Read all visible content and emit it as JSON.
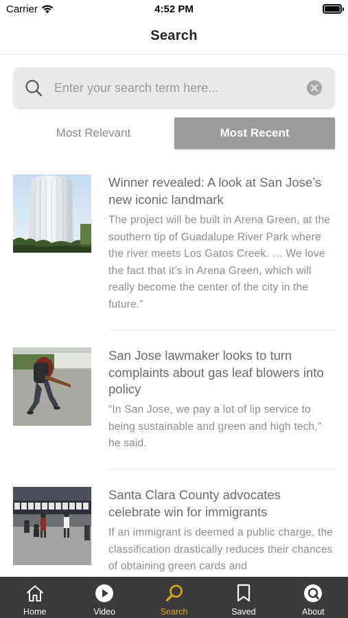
{
  "status_bar": {
    "carrier": "Carrier",
    "time": "4:52 PM"
  },
  "nav": {
    "title": "Search"
  },
  "search": {
    "placeholder": "Enter your search term here..."
  },
  "segments": {
    "relevant": "Most Relevant",
    "recent": "Most Recent",
    "selected": "Most Recent"
  },
  "articles": [
    {
      "title": "Winner revealed: A look at San Jose’s new iconic landmark",
      "excerpt": "The project will be built in Arena Green, at the southern tip of Guadalupe River Park where the river meets Los Gatos Creek. … We love the fact that it’s in Arena Green, which will really become the center of the city in the future.”"
    },
    {
      "title": "San Jose lawmaker looks to turn complaints about gas leaf blowers into policy",
      "excerpt": "“In San Jose, we pay a lot of lip service to being sustainable and green and high tech,” he said."
    },
    {
      "title": "Santa Clara County advocates celebrate win for immigrants",
      "excerpt": "If an immigrant is deemed a public charge, the classification drastically reduces their chances of obtaining green cards and"
    }
  ],
  "tabs": [
    {
      "label": "Home",
      "icon": "home-icon"
    },
    {
      "label": "Video",
      "icon": "play-icon"
    },
    {
      "label": "Search",
      "icon": "search-icon",
      "active": true
    },
    {
      "label": "Saved",
      "icon": "bookmark-icon"
    },
    {
      "label": "About",
      "icon": "about-icon"
    }
  ],
  "colors": {
    "accent": "#d9a81c",
    "tab_bar": "#3a3a3a",
    "segment_selected": "#9b9b9b"
  }
}
